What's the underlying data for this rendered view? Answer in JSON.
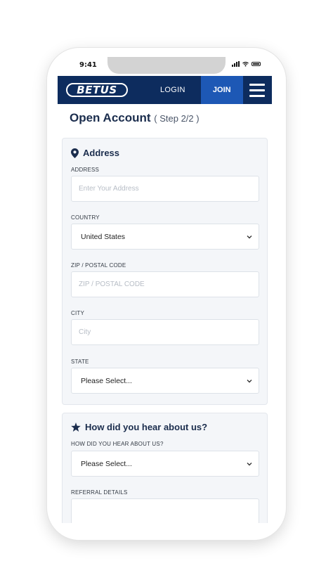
{
  "status_bar": {
    "time": "9:41"
  },
  "navbar": {
    "logo_text": "BETUS",
    "login_label": "LOGIN",
    "join_label": "JOIN"
  },
  "page": {
    "title": "Open Account",
    "step": "( Step 2/2 )"
  },
  "address_section": {
    "title": "Address",
    "address_label": "ADDRESS",
    "address_placeholder": "Enter Your Address",
    "country_label": "COUNTRY",
    "country_value": "United States",
    "zip_label": "ZIP / POSTAL CODE",
    "zip_placeholder": "ZIP / POSTAL CODE",
    "city_label": "CITY",
    "city_placeholder": "City",
    "state_label": "STATE",
    "state_value": "Please Select..."
  },
  "hear_section": {
    "title": "How did you hear about us?",
    "hear_label": "HOW DID YOU HEAR ABOUT US?",
    "hear_value": "Please Select...",
    "referral_label": "REFERRAL DETAILS",
    "referral_value": ""
  },
  "icons": {
    "address": "map-pin-icon",
    "hear": "star-icon",
    "dropdown": "chevron-down-icon",
    "menu": "hamburger-menu-icon"
  },
  "colors": {
    "navbar": "#0d2c5e",
    "join": "#1d58b5",
    "heading": "#1b2d4d",
    "card": "#f4f6f9"
  }
}
